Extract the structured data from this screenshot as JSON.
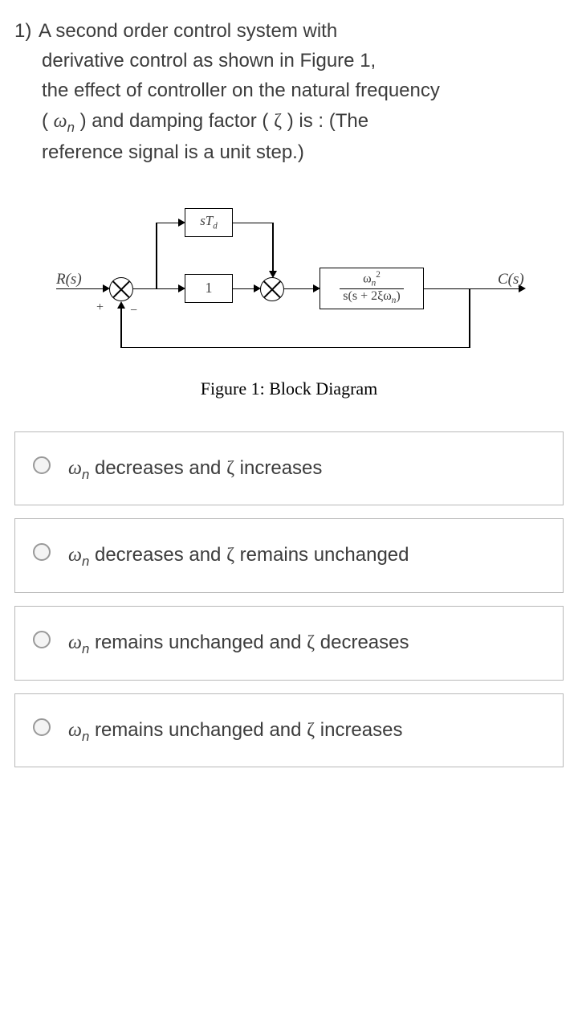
{
  "question": {
    "number": "1)",
    "line1": "A second order control system with",
    "line2": "derivative control as shown in Figure 1,",
    "line3": "the effect of controller on the natural frequency",
    "line4a": "( ",
    "omega": "ω",
    "omega_sub": "n",
    "line4b": " ) and damping factor ( ",
    "zeta": "ζ",
    "line4c": " ) is : (The",
    "line5": "reference signal is a unit step.)"
  },
  "diagram": {
    "r_label": "R(s)",
    "c_label": "C(s)",
    "box_td": "sT",
    "box_td_sub": "d",
    "box_one": "1",
    "plant_num_sym": "ω",
    "plant_num_sub": "n",
    "plant_num_sup": "2",
    "plant_den_a": "s(s + 2ξω",
    "plant_den_sub": "n",
    "plant_den_b": ")",
    "plus": "+",
    "minus": "−",
    "caption": "Figure 1: Block Diagram"
  },
  "options": {
    "a": {
      "pre": "",
      "mid": "  decreases and  ",
      "post": "  increases"
    },
    "b": {
      "pre": "",
      "mid": "  decreases and  ",
      "post": "  remains unchanged"
    },
    "c": {
      "pre": "",
      "mid": "  remains unchanged and  ",
      "post": " decreases"
    },
    "d": {
      "pre": "",
      "mid": "  remains unchanged and  ",
      "post": " increases"
    }
  }
}
